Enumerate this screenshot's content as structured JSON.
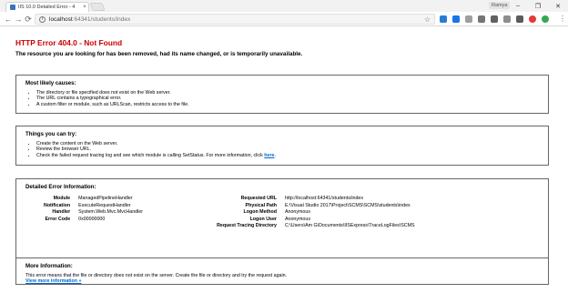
{
  "browser": {
    "tab_title": "IIS 10.0 Detailed Error - 4",
    "tab_close": "×",
    "profile_label": "Ramya",
    "window_controls": {
      "minimize": "–",
      "maximize": "❐",
      "close": "✕"
    },
    "nav": {
      "back": "←",
      "forward": "→",
      "reload": "⟳"
    },
    "url_host": "localhost",
    "url_path": ":64341/students/index",
    "colors": {
      "tab_favicon": "#3b73b9"
    }
  },
  "error": {
    "title": "HTTP Error 404.0 - Not Found",
    "subtitle": "The resource you are looking for has been removed, had its name changed, or is temporarily unavailable."
  },
  "causes": {
    "heading": "Most likely causes:",
    "items": [
      "The directory or file specified does not exist on the Web server.",
      "The URL contains a typographical error.",
      "A custom filter or module, such as URLScan, restricts access to the file."
    ]
  },
  "try": {
    "heading": "Things you can try:",
    "items": [
      "Create the content on the Web server.",
      "Review the browser URL."
    ],
    "last_item_text": "Check the failed request tracing log and see which module is calling SetStatus. For more information, click ",
    "last_item_link": "here",
    "last_item_end": "."
  },
  "details": {
    "heading": "Detailed Error Information:",
    "left": [
      {
        "label": "Module",
        "value": "ManagedPipelineHandler"
      },
      {
        "label": "Notification",
        "value": "ExecuteRequestHandler"
      },
      {
        "label": "Handler",
        "value": "System.Web.Mvc.MvcHandler"
      },
      {
        "label": "Error Code",
        "value": "0x00000000"
      }
    ],
    "right": [
      {
        "label": "Requested URL",
        "value": "http://localhost:64341/students/index"
      },
      {
        "label": "Physical Path",
        "value": "E:\\Visual Studio 2017\\Project\\SCMS\\SCMS\\students\\index"
      },
      {
        "label": "Logon Method",
        "value": "Anonymous"
      },
      {
        "label": "Logon User",
        "value": "Anonymous"
      },
      {
        "label": "Request Tracing Directory",
        "value": "C:\\Users\\Am G\\Documents\\IISExpress\\TraceLogFiles\\SCMS"
      }
    ]
  },
  "more": {
    "heading": "More Information:",
    "text": "This error means that the file or directory does not exist on the server. Create the file or directory and try the request again.",
    "link": "View more information »"
  }
}
